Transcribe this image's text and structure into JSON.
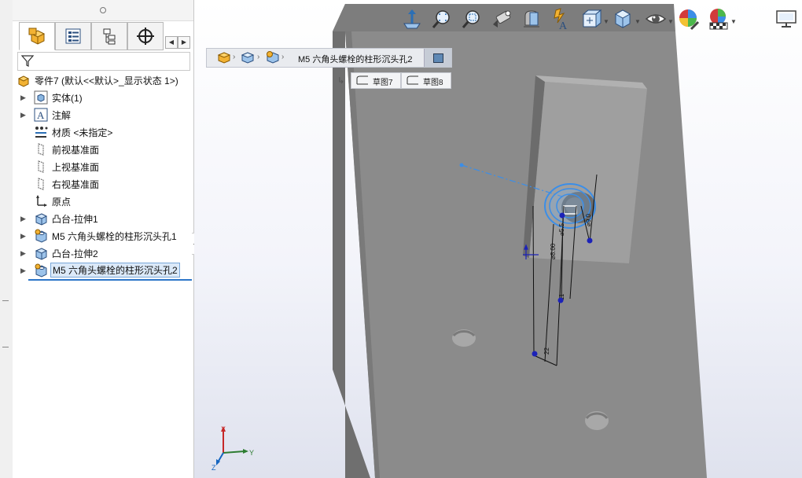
{
  "panel": {
    "tabs": [
      {
        "name": "featuremanager",
        "icon": "featuremanager-icon"
      },
      {
        "name": "propertymanager",
        "icon": "propertymanager-icon"
      },
      {
        "name": "configurationmanager",
        "icon": "configurationmanager-icon"
      },
      {
        "name": "dimxpertmanager",
        "icon": "dimxpert-icon"
      }
    ],
    "filter_icon": "filter-icon",
    "root_label": "零件7  (默认<<默认>_显示状态 1>)",
    "items": [
      {
        "label": "实体(1)",
        "icon": "solid-bodies-icon",
        "expandable": true
      },
      {
        "label": "注解",
        "icon": "annotations-icon",
        "expandable": true
      },
      {
        "label": "材质 <未指定>",
        "icon": "material-icon",
        "expandable": false
      },
      {
        "label": "前视基准面",
        "icon": "plane-icon",
        "expandable": false
      },
      {
        "label": "上视基准面",
        "icon": "plane-icon",
        "expandable": false
      },
      {
        "label": "右视基准面",
        "icon": "plane-icon",
        "expandable": false
      },
      {
        "label": "原点",
        "icon": "origin-icon",
        "expandable": false
      },
      {
        "label": "凸台-拉伸1",
        "icon": "boss-extrude-icon",
        "expandable": true
      },
      {
        "label": "M5 六角头螺栓的柱形沉头孔1",
        "icon": "hole-wizard-icon",
        "expandable": true
      },
      {
        "label": "凸台-拉伸2",
        "icon": "boss-extrude-icon",
        "expandable": true
      },
      {
        "label": "M5 六角头螺栓的柱形沉头孔2",
        "icon": "hole-wizard-icon",
        "expandable": true,
        "selected": true
      }
    ]
  },
  "viewport": {
    "hud_tools": [
      "normal-to-icon",
      "zoom-to-fit-icon",
      "zoom-to-area-icon",
      "previous-view-icon",
      "section-view-icon",
      "dynamic-annotation-icon",
      "view-orientation-icon",
      "display-style-icon",
      "hide-show-icon",
      "edit-appearance-icon",
      "apply-scene-icon",
      "view-settings-icon"
    ],
    "breadcrumb": {
      "label": "M5 六角头螺栓的柱形沉头孔2",
      "icons": [
        "part-icon",
        "solid-body-icon",
        "hole-feature-icon"
      ],
      "end_icon": "sketch-square-icon"
    },
    "sketches": [
      {
        "label": "草图7",
        "icon": "sketch-icon"
      },
      {
        "label": "草图8",
        "icon": "sketch-icon"
      }
    ],
    "triad": {
      "x": "X",
      "y": "Y",
      "z": "Z"
    },
    "colors": {
      "part": "#8a8a8a",
      "part_light": "#a0a0a0",
      "part_dark": "#6e6e6e",
      "selection": "#3b8ee8",
      "sketch_point": "#1c22b8"
    }
  }
}
